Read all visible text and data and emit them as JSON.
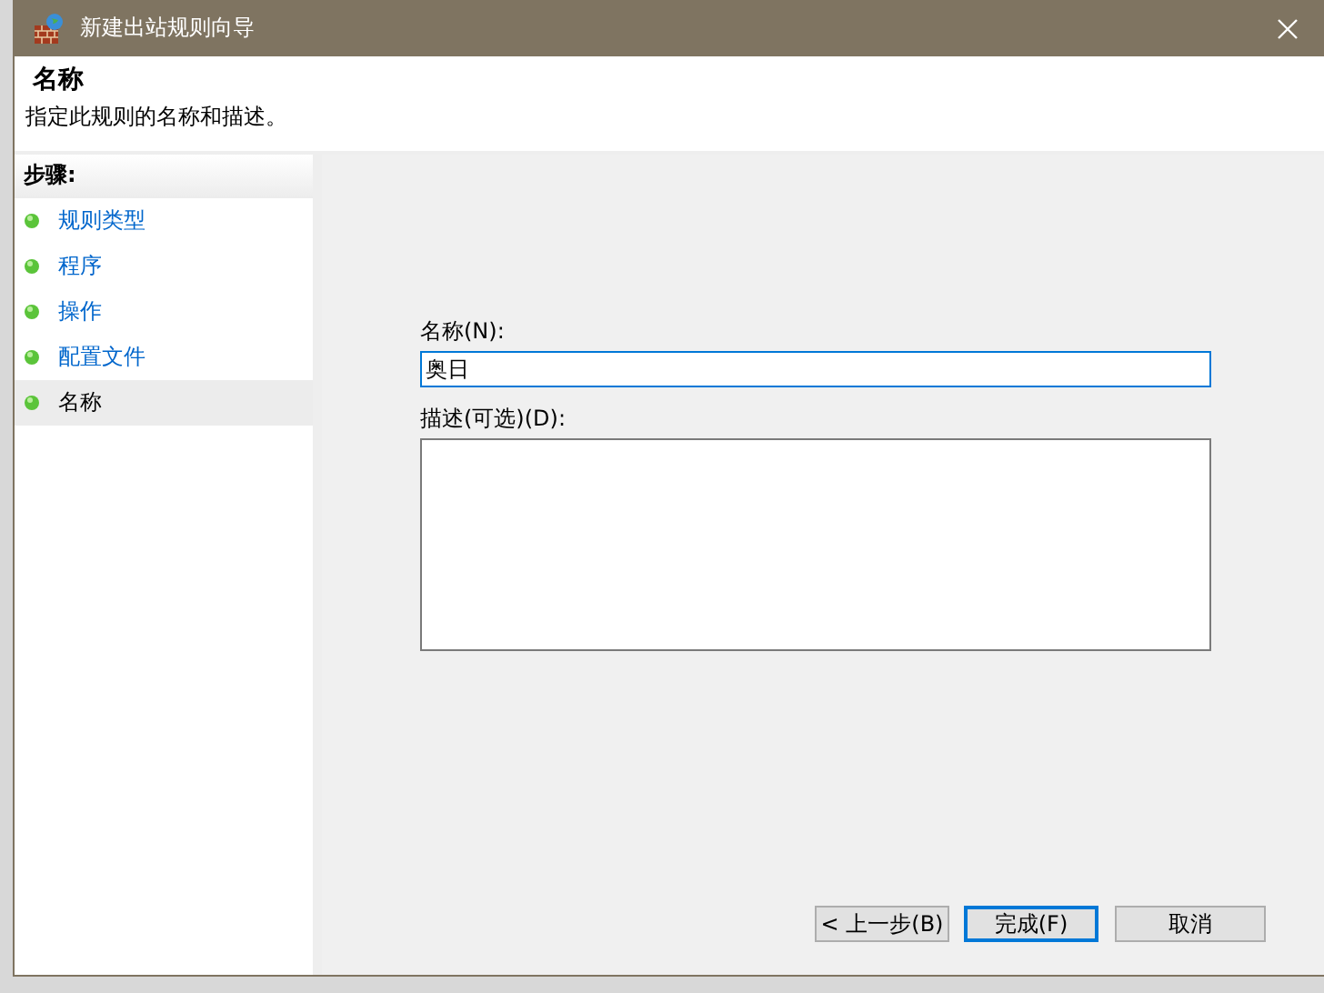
{
  "window": {
    "title": "新建出站规则向导"
  },
  "header": {
    "title": "名称",
    "subtitle": "指定此规则的名称和描述。"
  },
  "steps": {
    "title": "步骤:",
    "items": [
      {
        "label": "规则类型",
        "selected": false
      },
      {
        "label": "程序",
        "selected": false
      },
      {
        "label": "操作",
        "selected": false
      },
      {
        "label": "配置文件",
        "selected": false
      },
      {
        "label": "名称",
        "selected": true
      }
    ]
  },
  "form": {
    "name_label": "名称(N):",
    "name_value": "奥日",
    "description_label": "描述(可选)(D):"
  },
  "buttons": [
    {
      "label": "< 上一步(B)",
      "default": false
    },
    {
      "label": "完成(F)",
      "default": true
    },
    {
      "label": "取消",
      "default": false
    }
  ]
}
